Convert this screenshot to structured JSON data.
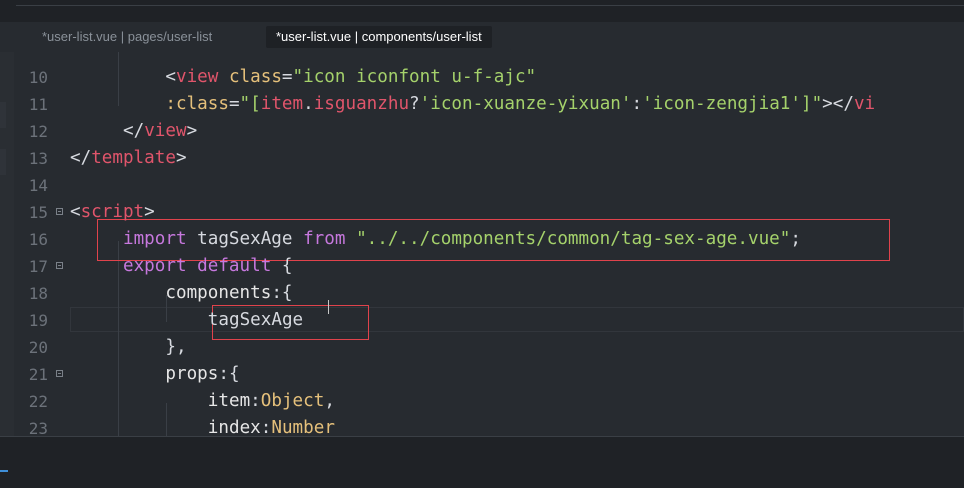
{
  "tabs": [
    {
      "label": "*user-list.vue | pages/user-list",
      "active": false
    },
    {
      "label": "*user-list.vue | components/user-list",
      "active": true
    }
  ],
  "editor": {
    "lines": [
      {
        "n": "10",
        "parts": [
          {
            "t": "<",
            "c": "punc"
          },
          {
            "t": "view",
            "c": "tag"
          },
          {
            "t": " class",
            "c": "attr"
          },
          {
            "t": "=",
            "c": "punc"
          },
          {
            "t": "\"icon iconfont u-f-ajc\"",
            "c": "str"
          }
        ]
      },
      {
        "n": "11",
        "parts": [
          {
            "t": ":class",
            "c": "attr"
          },
          {
            "t": "=",
            "c": "punc"
          },
          {
            "t": "\"[",
            "c": "str"
          },
          {
            "t": "item",
            "c": "sym"
          },
          {
            "t": ".",
            "c": "punc"
          },
          {
            "t": "isguanzhu",
            "c": "sym"
          },
          {
            "t": "?",
            "c": "punc"
          },
          {
            "t": "'icon-xuanze-yixuan'",
            "c": "str"
          },
          {
            "t": ":",
            "c": "punc"
          },
          {
            "t": "'icon-zengjia1'",
            "c": "str"
          },
          {
            "t": "]\"",
            "c": "str"
          },
          {
            "t": "></",
            "c": "punc"
          },
          {
            "t": "vi",
            "c": "tag"
          }
        ]
      },
      {
        "n": "12",
        "parts": [
          {
            "t": "</",
            "c": "punc"
          },
          {
            "t": "view",
            "c": "tag"
          },
          {
            "t": ">",
            "c": "punc"
          }
        ]
      },
      {
        "n": "13",
        "parts": [
          {
            "t": "</",
            "c": "punc"
          },
          {
            "t": "template",
            "c": "tag"
          },
          {
            "t": ">",
            "c": "punc"
          }
        ]
      },
      {
        "n": "14",
        "parts": []
      },
      {
        "n": "15",
        "parts": [
          {
            "t": "<",
            "c": "punc"
          },
          {
            "t": "script",
            "c": "tag"
          },
          {
            "t": ">",
            "c": "punc"
          }
        ]
      },
      {
        "n": "16",
        "parts": [
          {
            "t": "import",
            "c": "kw"
          },
          {
            "t": " tagSexAge ",
            "c": "id"
          },
          {
            "t": "from",
            "c": "kw"
          },
          {
            "t": " ",
            "c": "id"
          },
          {
            "t": "\"../../components/common/tag-sex-age.vue\"",
            "c": "str"
          },
          {
            "t": ";",
            "c": "punc"
          }
        ]
      },
      {
        "n": "17",
        "parts": [
          {
            "t": "export",
            "c": "kw"
          },
          {
            "t": " default",
            "c": "kw"
          },
          {
            "t": " {",
            "c": "punc"
          }
        ]
      },
      {
        "n": "18",
        "parts": [
          {
            "t": "components",
            "c": "prop"
          },
          {
            "t": ":{",
            "c": "punc"
          }
        ]
      },
      {
        "n": "19",
        "parts": [
          {
            "t": "tagSexAge",
            "c": "id"
          }
        ]
      },
      {
        "n": "20",
        "parts": [
          {
            "t": "},",
            "c": "punc"
          }
        ]
      },
      {
        "n": "21",
        "parts": [
          {
            "t": "props",
            "c": "prop"
          },
          {
            "t": ":{",
            "c": "punc"
          }
        ]
      },
      {
        "n": "22",
        "parts": [
          {
            "t": "item",
            "c": "prop"
          },
          {
            "t": ":",
            "c": "punc"
          },
          {
            "t": "Object",
            "c": "type"
          },
          {
            "t": ",",
            "c": "punc"
          }
        ]
      },
      {
        "n": "23",
        "parts": [
          {
            "t": "index",
            "c": "prop"
          },
          {
            "t": ":",
            "c": "punc"
          },
          {
            "t": "Number",
            "c": "type"
          }
        ]
      }
    ]
  }
}
